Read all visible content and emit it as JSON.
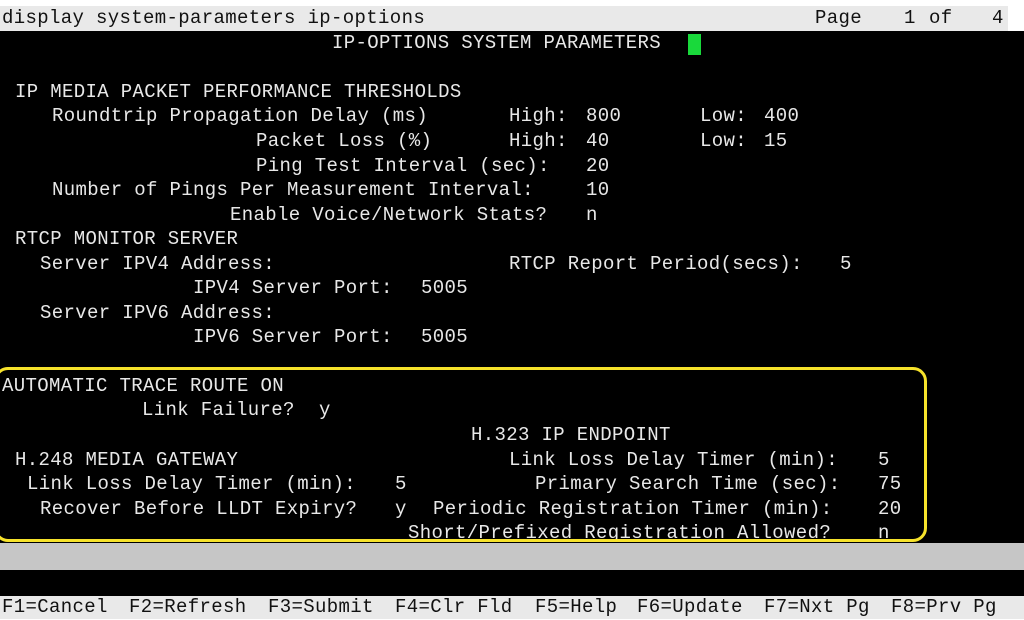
{
  "header": {
    "command": "display system-parameters ip-options",
    "page_label": "Page",
    "page_current": "1",
    "page_of": "of",
    "page_total": "4"
  },
  "form": {
    "title": "IP-OPTIONS SYSTEM PARAMETERS",
    "packet_thresholds": {
      "heading": "IP MEDIA PACKET PERFORMANCE THRESHOLDS",
      "roundtrip_label": "Roundtrip Propagation Delay (ms)",
      "roundtrip_high_label": "High:",
      "roundtrip_high": "800",
      "roundtrip_low_label": "Low:",
      "roundtrip_low": "400",
      "packet_loss_label": "Packet Loss (%)",
      "packet_loss_high_label": "High:",
      "packet_loss_high": "40",
      "packet_loss_low_label": "Low:",
      "packet_loss_low": "15",
      "ping_interval_label": "Ping Test Interval (sec):",
      "ping_interval": "20",
      "pings_per_interval_label": "Number of Pings Per Measurement Interval:",
      "pings_per_interval": "10",
      "voice_stats_label": "Enable Voice/Network Stats?",
      "voice_stats": "n"
    },
    "rtcp": {
      "heading": "RTCP MONITOR SERVER",
      "ipv4_address_label": "Server IPV4 Address:",
      "ipv4_address": "",
      "report_period_label": "RTCP Report Period(secs):",
      "report_period": "5",
      "ipv4_port_label": "IPV4 Server Port:",
      "ipv4_port": "5005",
      "ipv6_address_label": "Server IPV6 Address:",
      "ipv6_address": "",
      "ipv6_port_label": "IPV6 Server Port:",
      "ipv6_port": "5005"
    },
    "trace_route": {
      "heading": "AUTOMATIC TRACE ROUTE ON",
      "link_failure_label": "Link Failure?",
      "link_failure": "y"
    },
    "h323": {
      "heading": "H.323 IP ENDPOINT",
      "link_loss_label": "Link Loss Delay Timer (min):",
      "link_loss": "5",
      "primary_search_label": "Primary Search Time (sec):",
      "primary_search": "75",
      "periodic_reg_label": "Periodic Registration Timer (min):",
      "periodic_reg": "20",
      "short_prefixed_label": "Short/Prefixed Registration Allowed?",
      "short_prefixed": "n"
    },
    "h248": {
      "heading": "H.248 MEDIA GATEWAY",
      "link_loss_label": "Link Loss Delay Timer (min):",
      "link_loss": "5",
      "recover_label": "Recover Before LLDT Expiry?",
      "recover": "y"
    }
  },
  "function_keys": [
    {
      "label": "F1=Cancel"
    },
    {
      "label": "F2=Refresh"
    },
    {
      "label": "F3=Submit"
    },
    {
      "label": "F4=Clr Fld"
    },
    {
      "label": "F5=Help"
    },
    {
      "label": "F6=Update"
    },
    {
      "label": "F7=Nxt Pg"
    },
    {
      "label": "F8=Prv Pg"
    }
  ],
  "colors": {
    "terminal_bg": "#000000",
    "terminal_text": "#e8e8e8",
    "status_bar_bg": "#e9e9e9",
    "cursor": "#19d93b",
    "highlight_box": "#f6e22b"
  }
}
